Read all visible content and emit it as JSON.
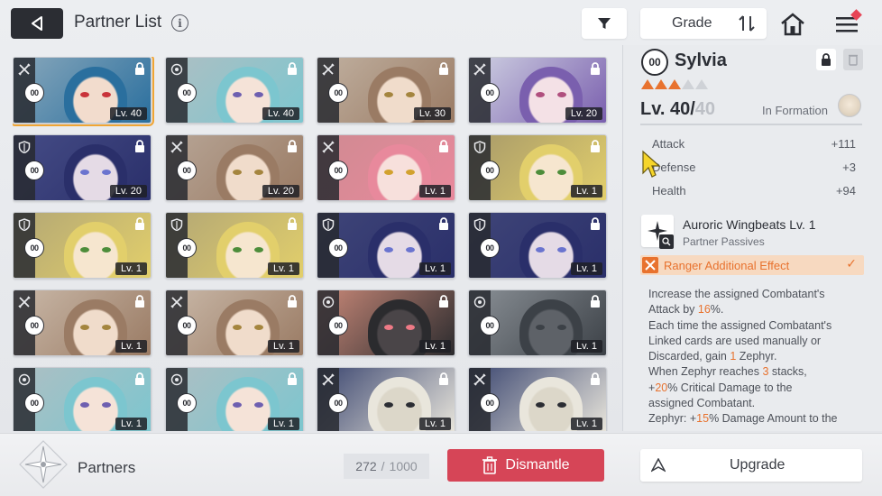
{
  "header": {
    "title": "Partner List",
    "info_glyph": "i",
    "grade_label": "Grade"
  },
  "cards": [
    {
      "level": "Lv. 40",
      "cls": "sword",
      "hair": "#2a6f9e",
      "skin": "#f2dccd",
      "bg": "#88a7bb",
      "eye": "#c9333a",
      "selected": true
    },
    {
      "level": "Lv. 40",
      "cls": "target",
      "hair": "#7cc6cf",
      "skin": "#f5e3d8",
      "bg": "#aebfc3",
      "eye": "#6e5fb0",
      "selected": false
    },
    {
      "level": "Lv. 30",
      "cls": "sword",
      "hair": "#9a7b64",
      "skin": "#f0dccb",
      "bg": "#c0b0a0",
      "eye": "#a4853e",
      "selected": false
    },
    {
      "level": "Lv. 20",
      "cls": "sword",
      "hair": "#7a5fae",
      "skin": "#f4e1e6",
      "bg": "#cfd1e2",
      "eye": "#b04f7e",
      "selected": false
    },
    {
      "level": "Lv. 20",
      "cls": "shield",
      "hair": "#2a2f6a",
      "skin": "#e5dbe6",
      "bg": "#454c86",
      "eye": "#6a74cf",
      "selected": false
    },
    {
      "level": "Lv. 20",
      "cls": "sword",
      "hair": "#9a7b64",
      "skin": "#f0dccb",
      "bg": "#b7a596",
      "eye": "#a4853e",
      "selected": false
    },
    {
      "level": "Lv. 1",
      "cls": "sword",
      "hair": "#e8899c",
      "skin": "#f7e0dc",
      "bg": "#d08a92",
      "eye": "#d2a12e",
      "selected": false
    },
    {
      "level": "Lv. 1",
      "cls": "shield",
      "hair": "#e2cf6b",
      "skin": "#f6e6cf",
      "bg": "#a89a6a",
      "eye": "#4d8d3a",
      "selected": false
    },
    {
      "level": "Lv. 1",
      "cls": "shield",
      "hair": "#e2cf6b",
      "skin": "#f6e6cf",
      "bg": "#b3a775",
      "eye": "#4d8d3a",
      "selected": false
    },
    {
      "level": "Lv. 1",
      "cls": "shield",
      "hair": "#e2cf6b",
      "skin": "#f6e6cf",
      "bg": "#b3a775",
      "eye": "#4d8d3a",
      "selected": false
    },
    {
      "level": "Lv. 1",
      "cls": "shield",
      "hair": "#2a2f6a",
      "skin": "#e5dbe6",
      "bg": "#3f4578",
      "eye": "#6a74cf",
      "selected": false
    },
    {
      "level": "Lv. 1",
      "cls": "shield",
      "hair": "#2a2f6a",
      "skin": "#e5dbe6",
      "bg": "#3f4578",
      "eye": "#6a74cf",
      "selected": false
    },
    {
      "level": "Lv. 1",
      "cls": "sword",
      "hair": "#9a7b64",
      "skin": "#f0dccb",
      "bg": "#c9b8a8",
      "eye": "#a4853e",
      "selected": false
    },
    {
      "level": "Lv. 1",
      "cls": "sword",
      "hair": "#9a7b64",
      "skin": "#f0dccb",
      "bg": "#c9b8a8",
      "eye": "#a4853e",
      "selected": false
    },
    {
      "level": "Lv. 1",
      "cls": "target",
      "hair": "#2b2b2e",
      "skin": "#4a4548",
      "bg": "#c88878",
      "eye": "#ef7a86",
      "selected": false
    },
    {
      "level": "Lv. 1",
      "cls": "target",
      "hair": "#3c4147",
      "skin": "#5e6268",
      "bg": "#8a9096",
      "eye": "#3c4147",
      "selected": false
    },
    {
      "level": "Lv. 1",
      "cls": "target",
      "hair": "#7cc6cf",
      "skin": "#f5e3d8",
      "bg": "#aebfc3",
      "eye": "#6e5fb0",
      "selected": false
    },
    {
      "level": "Lv. 1",
      "cls": "target",
      "hair": "#7cc6cf",
      "skin": "#f5e3d8",
      "bg": "#aebfc3",
      "eye": "#6e5fb0",
      "selected": false
    },
    {
      "level": "Lv. 1",
      "cls": "sword",
      "hair": "#e9e6dc",
      "skin": "#dcd7c9",
      "bg": "#3b4670",
      "eye": "#2b2d33",
      "selected": false
    },
    {
      "level": "Lv. 1",
      "cls": "sword",
      "hair": "#e9e6dc",
      "skin": "#dcd7c9",
      "bg": "#3b4670",
      "eye": "#2b2d33",
      "selected": false
    }
  ],
  "slot_glyph": "00",
  "details": {
    "name": "Sylvia",
    "rarity_filled": 3,
    "rarity_total": 5,
    "level": "Lv. 40/",
    "level_max": "40",
    "in_formation": "In Formation",
    "stats": [
      {
        "name": "Attack",
        "value": "+111"
      },
      {
        "name": "Defense",
        "value": "+3"
      },
      {
        "name": "Health",
        "value": "+94"
      }
    ],
    "passive_name": "Auroric Wingbeats Lv. 1",
    "passive_type": "Partner Passives",
    "effect_label": "Ranger Additional Effect",
    "effect_check": "✓",
    "desc": {
      "l1": "Increase the assigned Combatant's",
      "l2a": "Attack by ",
      "l2b": "16",
      "l2c": "%.",
      "l3": "Each time the assigned Combatant's",
      "l4": "Linked cards are used manually or",
      "l5a": "Discarded, gain ",
      "l5b": "1",
      "l5c": " Zephyr.",
      "l6a": "When Zephyr reaches ",
      "l6b": "3",
      "l6c": " stacks,",
      "l7a": "+",
      "l7b": "20",
      "l7c": "% Critical Damage to the",
      "l8": "assigned Combatant.",
      "l9a": "Zephyr: +",
      "l9b": "15",
      "l9c": "% Damage Amount to the"
    }
  },
  "footer": {
    "partners_label": "Partners",
    "count_current": "272",
    "count_sep": "/",
    "count_total": "1000",
    "dismantle_label": "Dismantle",
    "upgrade_label": "Upgrade"
  },
  "colors": {
    "accent_orange": "#e8722e",
    "dismantle_red": "#d64557",
    "selected_border": "#f0a534"
  }
}
